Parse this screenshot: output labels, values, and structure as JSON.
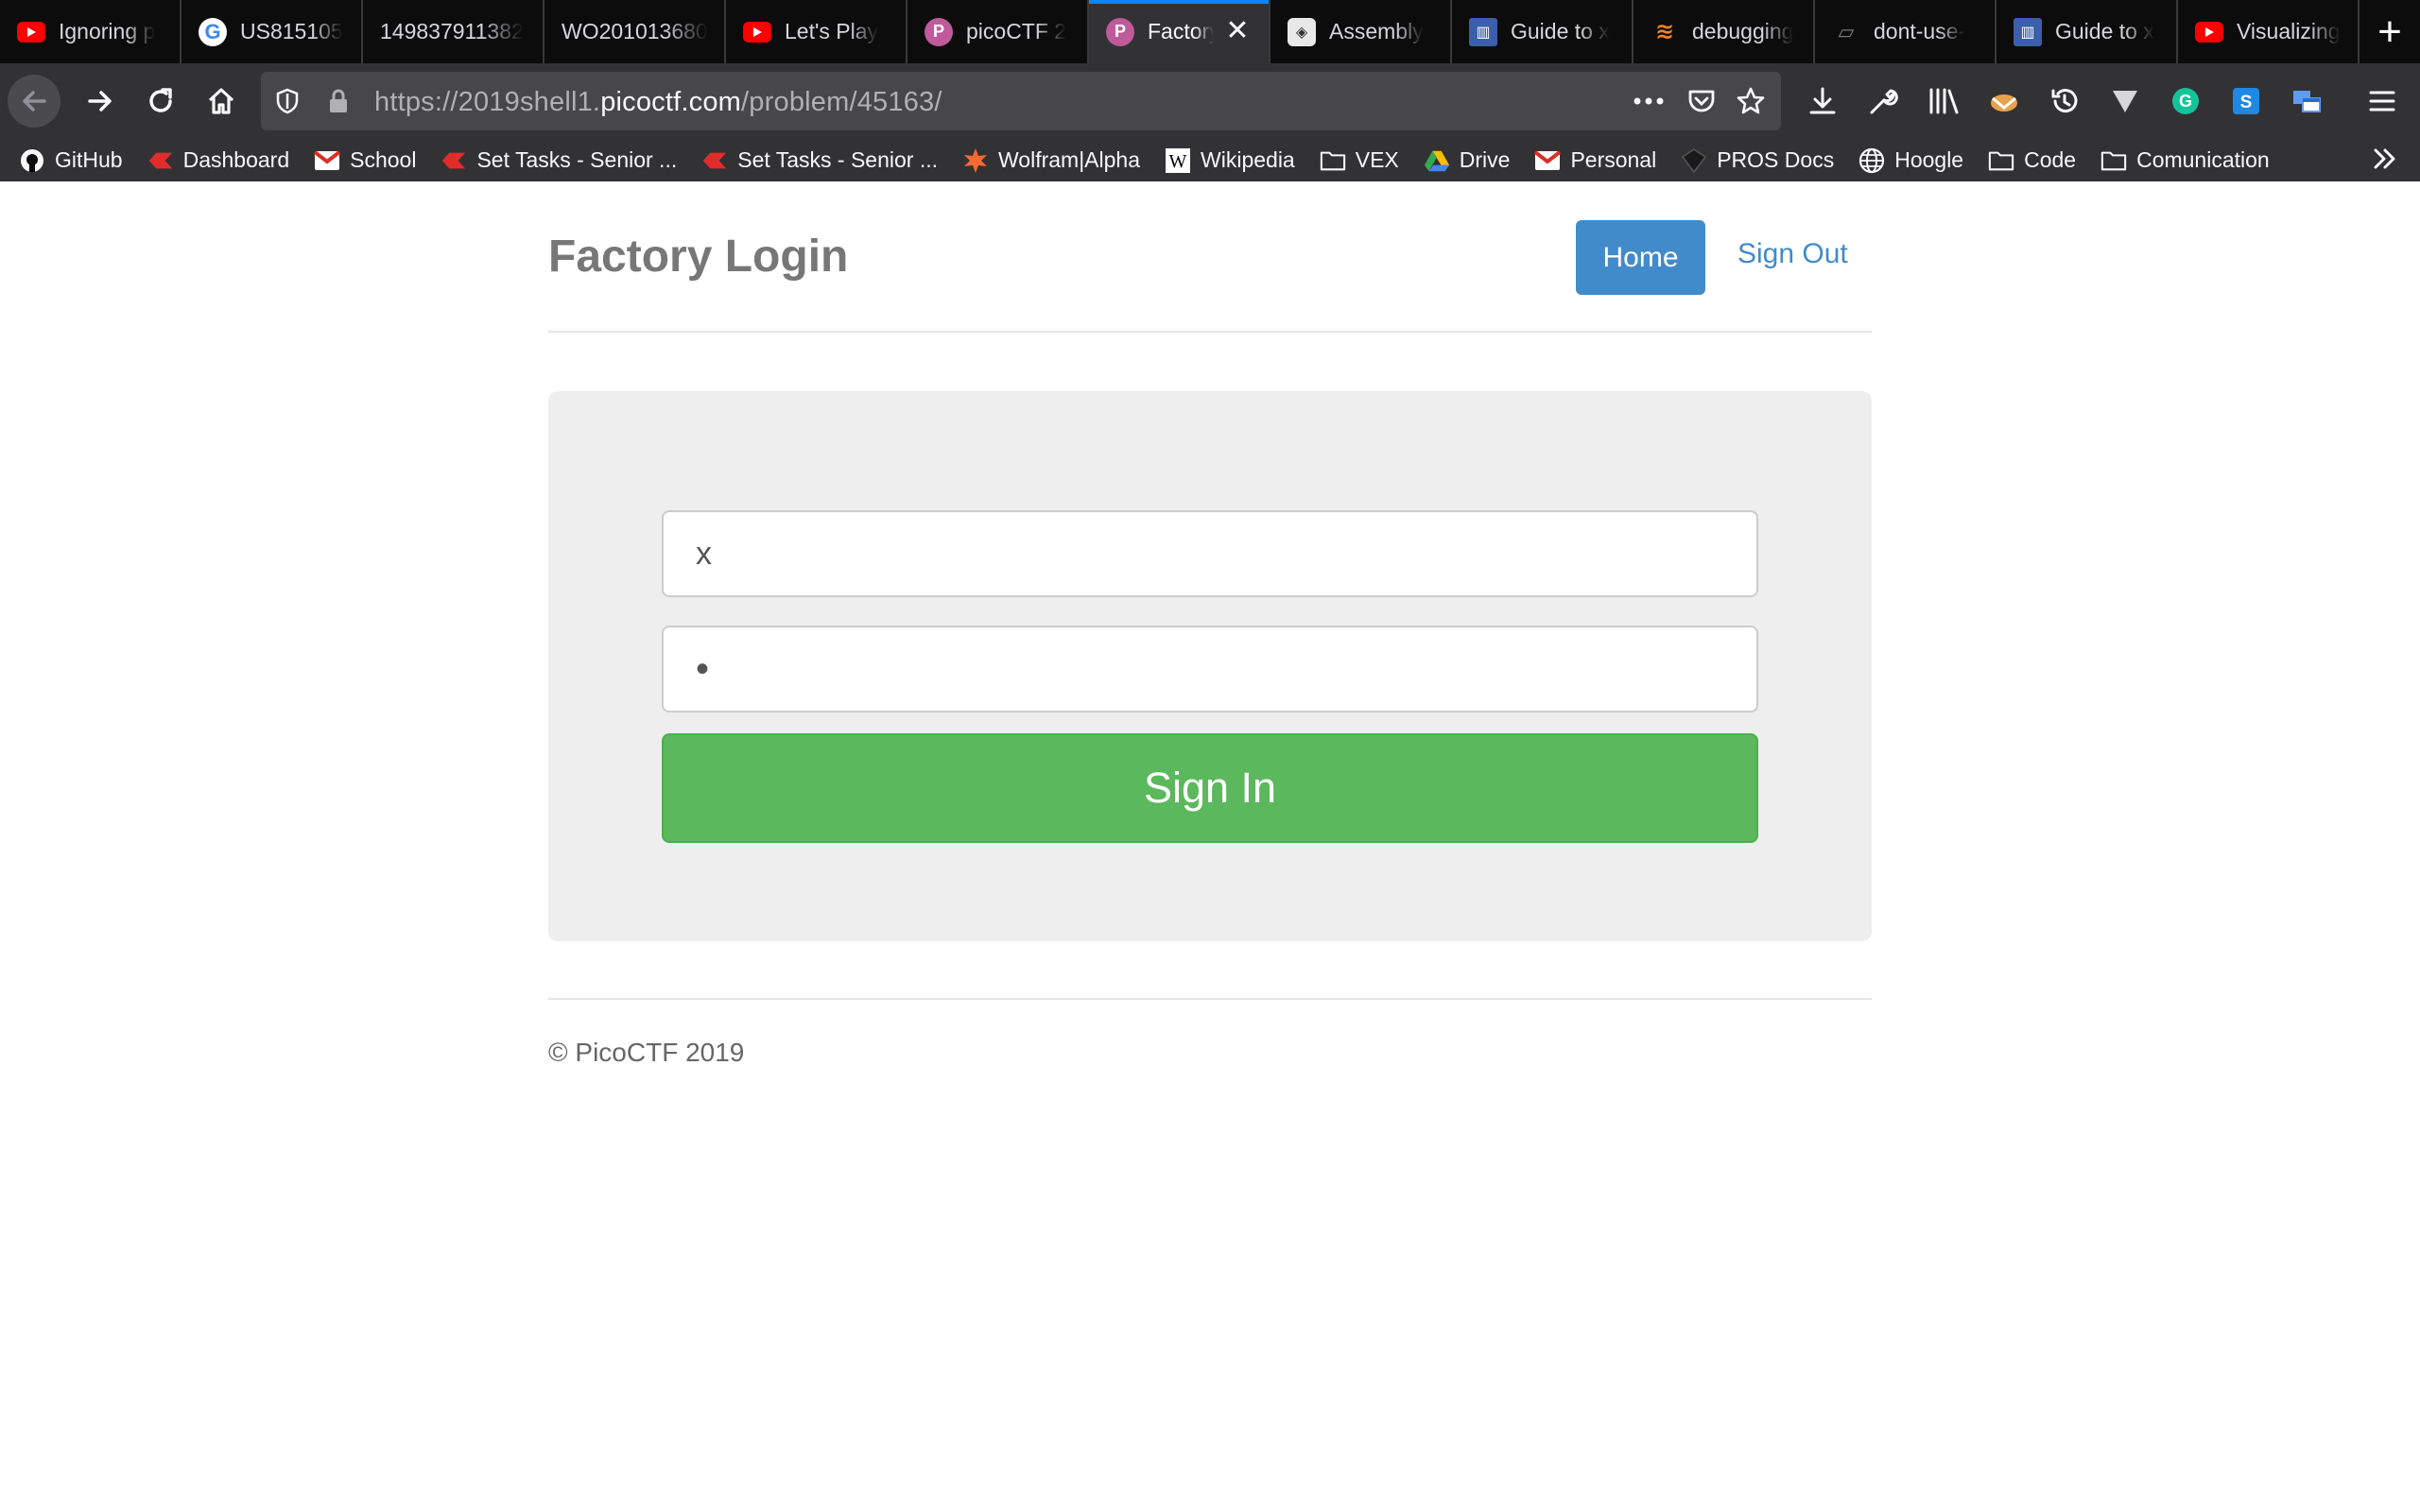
{
  "browser": {
    "tabs": [
      {
        "title": "Ignoring p",
        "icon": "youtube-icon",
        "color": "#ff0000"
      },
      {
        "title": "US815105",
        "icon": "google-icon",
        "color": "#ffffff"
      },
      {
        "title": "149837911382",
        "icon": "",
        "color": ""
      },
      {
        "title": "WO201013680",
        "icon": "",
        "color": ""
      },
      {
        "title": "Let's Play",
        "icon": "youtube-icon",
        "color": "#ff0000"
      },
      {
        "title": "picoCTF 2",
        "icon": "picoctf-icon",
        "color": "#c05a9a"
      },
      {
        "title": "Factory",
        "icon": "picoctf-icon",
        "color": "#c05a9a",
        "active": true
      },
      {
        "title": "Assembly",
        "icon": "assembly-icon",
        "color": "#ffffff"
      },
      {
        "title": "Guide to x",
        "icon": "university-icon",
        "color": "#3b5fa8"
      },
      {
        "title": "debugging",
        "icon": "stackoverflow-icon",
        "color": "#f48024"
      },
      {
        "title": "dont-use-",
        "icon": "page-icon",
        "color": "#555555"
      },
      {
        "title": "Guide to x",
        "icon": "university-icon",
        "color": "#3b5fa8"
      },
      {
        "title": "Visualizing",
        "icon": "youtube-icon",
        "color": "#ff0000"
      }
    ],
    "url": {
      "prefix": "https://2019shell1.",
      "host": "picoctf.com",
      "path": "/problem/45163/"
    },
    "bookmarks": [
      {
        "label": "GitHub",
        "icon": "github-icon"
      },
      {
        "label": "Dashboard",
        "icon": "canvas-icon"
      },
      {
        "label": "School",
        "icon": "gmail-icon"
      },
      {
        "label": "Set Tasks - Senior ...",
        "icon": "canvas-icon"
      },
      {
        "label": "Set Tasks - Senior ...",
        "icon": "canvas-icon"
      },
      {
        "label": "Wolfram|Alpha",
        "icon": "wolfram-icon"
      },
      {
        "label": "Wikipedia",
        "icon": "wikipedia-icon"
      },
      {
        "label": "VEX",
        "icon": "folder-icon"
      },
      {
        "label": "Drive",
        "icon": "drive-icon"
      },
      {
        "label": "Personal",
        "icon": "gmail-icon"
      },
      {
        "label": "PROS Docs",
        "icon": "pros-icon"
      },
      {
        "label": "Hoogle",
        "icon": "globe-icon"
      },
      {
        "label": "Code",
        "icon": "folder-icon"
      },
      {
        "label": "Comunication",
        "icon": "folder-icon"
      }
    ],
    "accent": "#0a84ff"
  },
  "site": {
    "brand": "Factory Login",
    "nav": {
      "home": "Home",
      "signout": "Sign Out"
    },
    "login": {
      "username_value": "x",
      "password_value": "•",
      "signin_label": "Sign In"
    },
    "footer": "© PicoCTF 2019",
    "colors": {
      "primary": "#428bca",
      "success": "#5cb85c"
    }
  }
}
